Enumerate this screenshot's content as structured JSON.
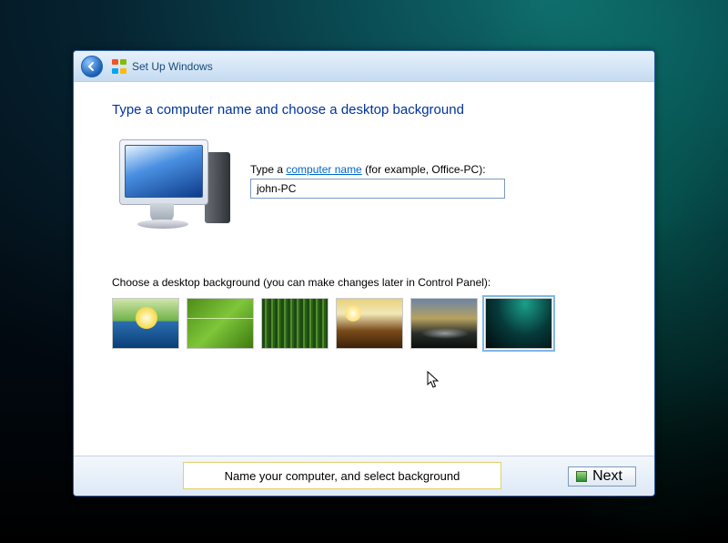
{
  "titlebar": {
    "title": "Set Up Windows"
  },
  "heading": "Type a computer name and choose a desktop background",
  "form": {
    "label_pre": "Type a ",
    "label_link": "computer name",
    "label_post": " (for example, Office-PC):",
    "value": "john-PC"
  },
  "bg_section": {
    "label": "Choose a desktop background (you can make changes later in Control Panel):",
    "thumbs": [
      {
        "name": "vista-hills",
        "selected": false
      },
      {
        "name": "green-leaf",
        "selected": false
      },
      {
        "name": "bamboo",
        "selected": false
      },
      {
        "name": "autumn-field",
        "selected": false
      },
      {
        "name": "mountain-reflection",
        "selected": false
      },
      {
        "name": "aurora",
        "selected": true
      }
    ]
  },
  "helper": "Name your computer, and select background",
  "next": "Next"
}
